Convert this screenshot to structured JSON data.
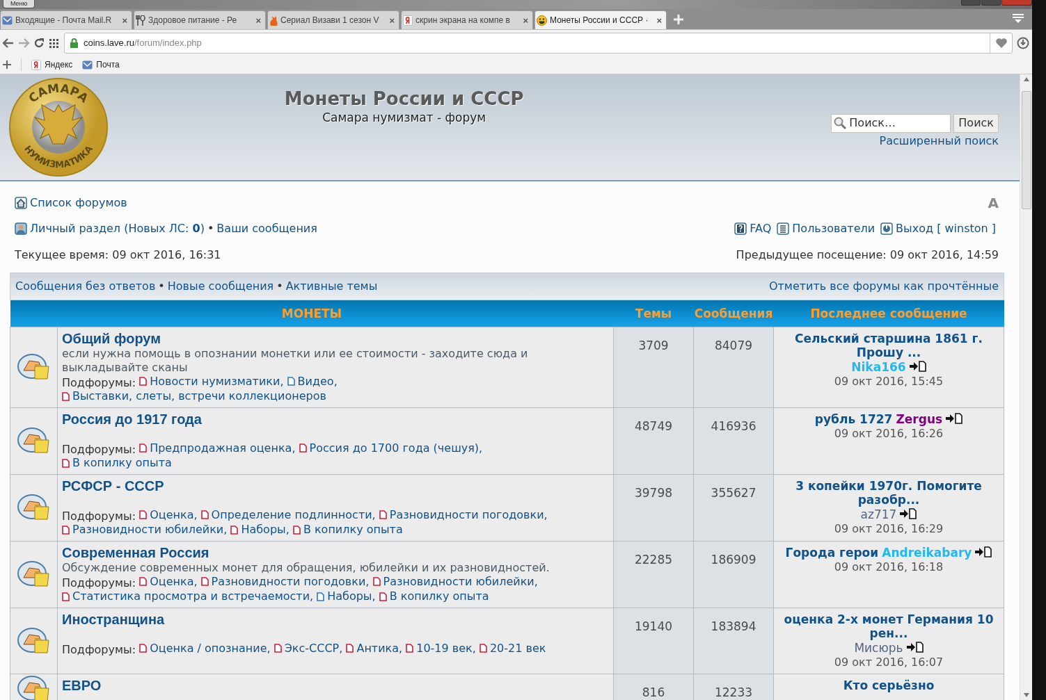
{
  "browser": {
    "menu_button": "Меню",
    "tabs": [
      {
        "title": "Входящие - Почта Mail.R",
        "close": "×",
        "selected": false
      },
      {
        "title": "Здоровое питание - Ре",
        "close": "×",
        "selected": false
      },
      {
        "title": "Сериал Визави 1 сезон V",
        "close": "×",
        "selected": false
      },
      {
        "title": "скрин экрана на компе в",
        "close": "×",
        "selected": false
      },
      {
        "title": "Монеты России и СССР ·",
        "close": "×",
        "selected": true
      }
    ],
    "address": {
      "host": "coins.lave.ru",
      "path": "/forum/index.php"
    },
    "bookmarks": [
      "Яндекс",
      "Почта"
    ]
  },
  "header": {
    "logo": {
      "top_text": "САМАРА",
      "bottom_text": "НУМИЗМАТИКА"
    },
    "title": "Монеты России и СССР",
    "subtitle": "Самара нумизмат - форум",
    "search": {
      "placeholder": "Поиск…",
      "button": "Поиск"
    },
    "advanced_search": "Расширенный поиск"
  },
  "nav": {
    "breadcrumb": "Список форумов",
    "text_size_toggle": "A",
    "personal": "Личный раздел (Новых ЛС: **0**)",
    "separator": "•",
    "own_posts": "Ваши сообщения",
    "right_links": [
      "FAQ",
      "Пользователи",
      "Выход [ winston ]"
    ],
    "current_time": "Текущее время: 09 окт 2016, 16:31",
    "last_visit": "Предыдущее посещение: 09 окт 2016, 14:59"
  },
  "quick_links": {
    "left": [
      "Сообщения без ответов",
      "Новые сообщения",
      "Активные темы"
    ],
    "separator": "•",
    "right": "Отметить все форумы как прочтённые"
  },
  "forum_table": {
    "columns": [
      "МОНЕТЫ",
      "Темы",
      "Сообщения",
      "Последнее сообщение"
    ],
    "rows": [
      {
        "title": "Общий форум",
        "description": "если нужна помощь в опознании монетки или ее стоимости - заходите сюда и выкладывайте сканы",
        "subforums_label": "Подфорумы:",
        "subforums": [
          {
            "name": "Новости нумизматики,",
            "unread": true
          },
          {
            "name": "Видео,",
            "unread": false
          },
          {
            "name": "Выставки, слеты, встречи коллекционеров",
            "unread": true
          }
        ],
        "topics": "3709",
        "posts": "84079",
        "last_post": {
          "title": "Сельский старшина 1861 г. Прошу ...",
          "author": "Nika166",
          "color": "#1eb9f0",
          "time": "09 окт 2016, 15:45"
        }
      },
      {
        "title": "Россия до 1917 года",
        "subforums_label": "Подфорумы:",
        "subforums": [
          {
            "name": "Предпродажная оценка,",
            "unread": true
          },
          {
            "name": "Россия до 1700 года (чешуя),",
            "unread": true
          },
          {
            "name": "В копилку опыта",
            "unread": true
          }
        ],
        "topics": "48749",
        "posts": "416936",
        "last_post": {
          "title": "рубль 1727",
          "author": "Zergus",
          "color": "#800080",
          "time": "09 окт 2016, 16:26"
        }
      },
      {
        "title": "РСФСР - СССР",
        "subforums_label": "Подфорумы:",
        "subforums": [
          {
            "name": "Оценка,",
            "unread": true
          },
          {
            "name": "Определение подлинности,",
            "unread": true
          },
          {
            "name": "Разновидности погодовки,",
            "unread": true
          },
          {
            "name": "Разновидности юбилейки,",
            "unread": true
          },
          {
            "name": "Наборы,",
            "unread": true
          },
          {
            "name": "В копилку опыта",
            "unread": true
          }
        ],
        "topics": "39798",
        "posts": "355627",
        "last_post": {
          "title": "3 копейки 1970г. Помогите разобр...",
          "author": "az717",
          "time": "09 окт 2016, 16:29"
        }
      },
      {
        "title": "Современная Россия",
        "description": "Обсуждение современных монет для обращения, юбилейки и их разновидностей.",
        "subforums_label": "Подфорумы:",
        "subforums": [
          {
            "name": "Оценка,",
            "unread": true
          },
          {
            "name": "Разновидности погодовки,",
            "unread": true
          },
          {
            "name": "Разновидности юбилейки,",
            "unread": true
          },
          {
            "name": "Статистика просмотра и встречаемости,",
            "unread": true
          },
          {
            "name": "Наборы,",
            "unread": false
          },
          {
            "name": "В копилку опыта",
            "unread": true
          }
        ],
        "topics": "22285",
        "posts": "186909",
        "last_post": {
          "title": "Города герои",
          "author": "Andreikabary",
          "color": "#1eb9f0",
          "time": "09 окт 2016, 16:18"
        }
      },
      {
        "title": "Иностранщина",
        "subforums_label": "Подфорумы:",
        "subforums": [
          {
            "name": "Оценка / опознание,",
            "unread": true
          },
          {
            "name": "Экс-СССР,",
            "unread": true
          },
          {
            "name": "Антика,",
            "unread": true
          },
          {
            "name": "10-19 век,",
            "unread": true
          },
          {
            "name": "20-21 век",
            "unread": true
          }
        ],
        "topics": "19140",
        "posts": "183894",
        "last_post": {
          "title": "оценка 2-х монет Германия 10 рен...",
          "author": "Мисюрь",
          "time": "09 окт 2016, 16:07"
        }
      },
      {
        "title": "ЕВРО",
        "topics": "816",
        "posts": "12233",
        "last_post": {
          "title": "Кто серьёзно"
        }
      }
    ]
  }
}
